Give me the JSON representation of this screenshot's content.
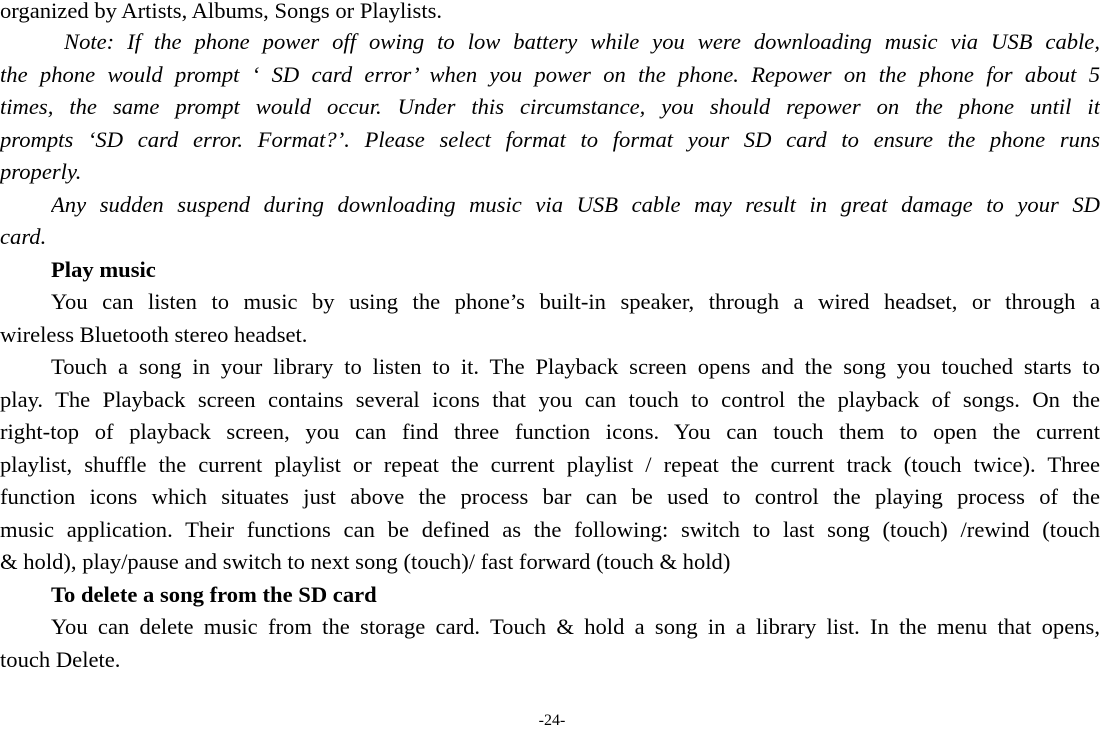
{
  "page": {
    "page_number": "-24-",
    "blocks": [
      {
        "type": "continuation",
        "style": "normal",
        "lines": [
          "organized by Artists, Albums, Songs or Playlists."
        ]
      },
      {
        "type": "note",
        "style": "italic",
        "lines": [
          "Note: If the phone power off owing to low battery while you were downloading music via USB cable,",
          "the phone would prompt ‘ SD card error’ when you power on the phone. Repower on the phone for about 5",
          "times, the same prompt would occur. Under this circumstance, you should repower on the phone until it",
          "prompts ‘SD card error. Format?’. Please select format to format your SD card to ensure the phone runs",
          "properly."
        ]
      },
      {
        "type": "note",
        "style": "italic",
        "lines": [
          "Any sudden suspend during downloading music via USB cable may result in great damage to your SD",
          "card."
        ]
      },
      {
        "type": "heading",
        "style": "bold",
        "lines": [
          "Play music"
        ]
      },
      {
        "type": "paragraph",
        "style": "normal",
        "lines": [
          "You can listen to music by using the phone’s built-in speaker, through a wired headset, or through a",
          "wireless Bluetooth stereo headset."
        ]
      },
      {
        "type": "paragraph",
        "style": "normal",
        "lines": [
          "Touch a song in your library to listen to it. The Playback screen opens and the song you touched starts to",
          "play. The Playback screen contains several icons that you can touch to control the playback of songs. On the",
          "right-top of playback screen, you can find three function icons. You can touch them to open the current",
          "playlist, shuffle the current playlist or repeat the current playlist / repeat the current track (touch twice). Three",
          "function icons which situates just above the process bar can be used to control the playing process of the",
          "music application. Their functions can be defined as the following: switch to last song (touch) /rewind (touch",
          "& hold), play/pause and switch to next song (touch)/ fast forward (touch & hold)"
        ]
      },
      {
        "type": "heading",
        "style": "bold",
        "lines": [
          "To delete a song from the SD card"
        ]
      },
      {
        "type": "paragraph",
        "style": "normal",
        "lines": [
          "You can delete music from the storage card. Touch & hold a song in a library list. In the menu that opens,",
          "touch Delete."
        ]
      }
    ]
  }
}
